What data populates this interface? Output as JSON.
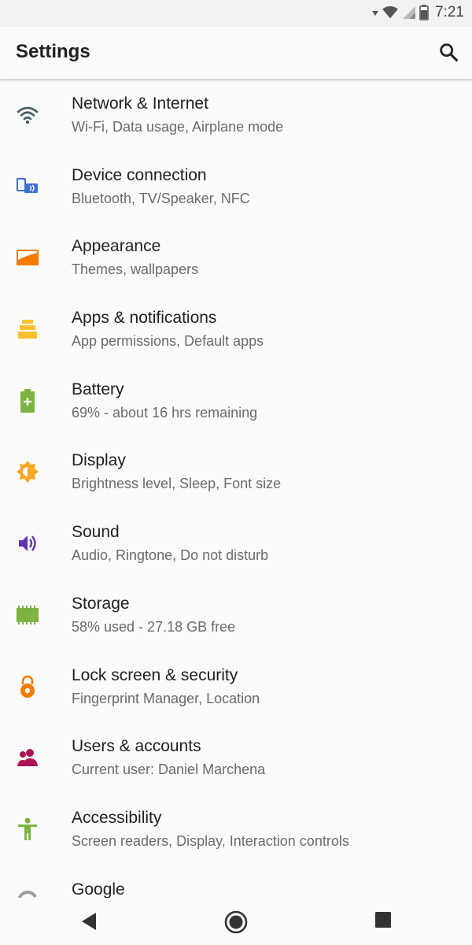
{
  "status_bar": {
    "time": "7:21"
  },
  "app_bar": {
    "title": "Settings",
    "search_icon": "search-icon"
  },
  "settings_items": [
    {
      "title": "Network & Internet",
      "subtitle": "Wi-Fi, Data usage, Airplane mode",
      "icon": "wifi-icon",
      "color": "#455a64"
    },
    {
      "title": "Device connection",
      "subtitle": "Bluetooth, TV/Speaker, NFC",
      "icon": "devices-icon",
      "color": "#3f6fd1"
    },
    {
      "title": "Appearance",
      "subtitle": "Themes, wallpapers",
      "icon": "wallpaper-icon",
      "color": "#f57c00"
    },
    {
      "title": "Apps & notifications",
      "subtitle": "App permissions, Default apps",
      "icon": "apps-icon",
      "color": "#fbc02d"
    },
    {
      "title": "Battery",
      "subtitle": "69% - about 16 hrs remaining",
      "icon": "battery-icon",
      "color": "#7cb342"
    },
    {
      "title": "Display",
      "subtitle": "Brightness level, Sleep, Font size",
      "icon": "brightness-icon",
      "color": "#f9a825"
    },
    {
      "title": "Sound",
      "subtitle": "Audio, Ringtone, Do not disturb",
      "icon": "volume-icon",
      "color": "#5e35b1"
    },
    {
      "title": "Storage",
      "subtitle": "58% used - 27.18 GB free",
      "icon": "storage-chip-icon",
      "color": "#7cb342"
    },
    {
      "title": "Lock screen & security",
      "subtitle": "Fingerprint Manager, Location",
      "icon": "lock-icon",
      "color": "#f57c00"
    },
    {
      "title": "Users & accounts",
      "subtitle": "Current user: Daniel Marchena",
      "icon": "users-icon",
      "color": "#ad1457"
    },
    {
      "title": "Accessibility",
      "subtitle": "Screen readers, Display, Interaction controls",
      "icon": "accessibility-icon",
      "color": "#7cb342"
    },
    {
      "title": "Google",
      "subtitle": "",
      "icon": "google-icon",
      "color": "#9e9e9e"
    }
  ],
  "nav_bar": {
    "back_icon": "back-icon",
    "home_icon": "home-icon",
    "recents_icon": "recents-icon"
  }
}
